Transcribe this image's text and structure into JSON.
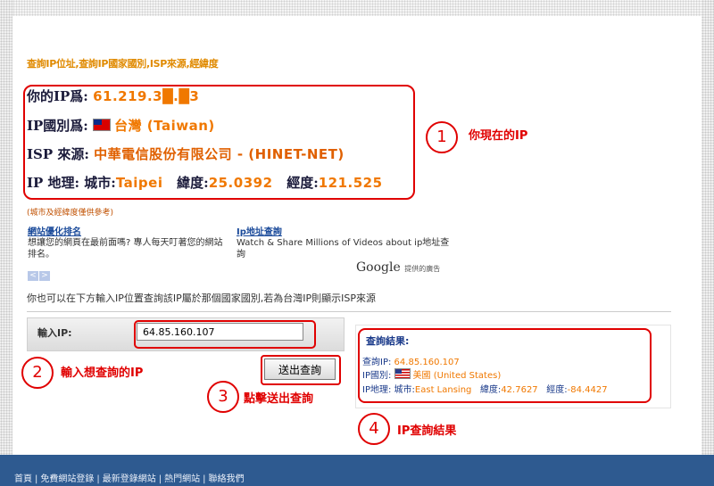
{
  "header": {
    "title": "查詢IP位址,查詢IP國家國別,ISP來源,經緯度"
  },
  "info": {
    "ip_label": "你的IP爲:",
    "ip_value": "61.219.3█.█3",
    "country_label": "IP國別爲:",
    "country_value": "台灣 (Taiwan)",
    "isp_label": "ISP 來源:",
    "isp_value": "中華電信股份有限公司 - (HINET-NET)",
    "geo_label": "IP 地理:",
    "city_label": "城市:",
    "city_value": "Taipei",
    "lat_label": "緯度:",
    "lat_value": "25.0392",
    "lon_label": "經度:",
    "lon_value": "121.525"
  },
  "annotations": [
    {
      "num": "1",
      "text": "你現在的IP"
    },
    {
      "num": "2",
      "text": "輸入想查詢的IP"
    },
    {
      "num": "3",
      "text": "點擊送出查詢"
    },
    {
      "num": "4",
      "text": "IP查詢結果"
    }
  ],
  "note": "(城市及經緯度僅供參考)",
  "ads": [
    {
      "title": "網站優化排名",
      "desc": "想讓您的網頁在最前面嗎? 專人每天叮著您的網站排名。"
    },
    {
      "title": "Ip地址查詢",
      "desc": "Watch & Share Millions of Videos about ip地址查詢"
    }
  ],
  "ad_nav": {
    "prev": "<",
    "next": ">"
  },
  "google": {
    "logo": "Google",
    "caption": "提供的廣告"
  },
  "hint": "你也可以在下方輸入IP位置查詢該IP屬於那個國家國別,若為台灣IP則顯示ISP來源",
  "form": {
    "label": "輸入IP:",
    "value": "64.85.160.107",
    "submit_label": "送出查詢"
  },
  "result": {
    "title": "查詢結果:",
    "ip_label": "查詢IP:",
    "ip_value": "64.85.160.107",
    "country_label": "IP國別:",
    "country_value": "美國 (United States)",
    "geo_label": "IP地理:",
    "city_label": "城市:",
    "city_value": "East Lansing",
    "lat_label": "緯度:",
    "lat_value": "42.7627",
    "lon_label": "經度:",
    "lon_value": "-84.4427"
  },
  "footer": {
    "links": [
      "首頁",
      "免費網站登錄",
      "最新登錄網站",
      "熱門網站",
      "聯絡我們"
    ]
  },
  "colors": {
    "accent": "#f07800",
    "annotation": "#e00000",
    "footer": "#2e5a90",
    "link": "#1a4a9a"
  }
}
